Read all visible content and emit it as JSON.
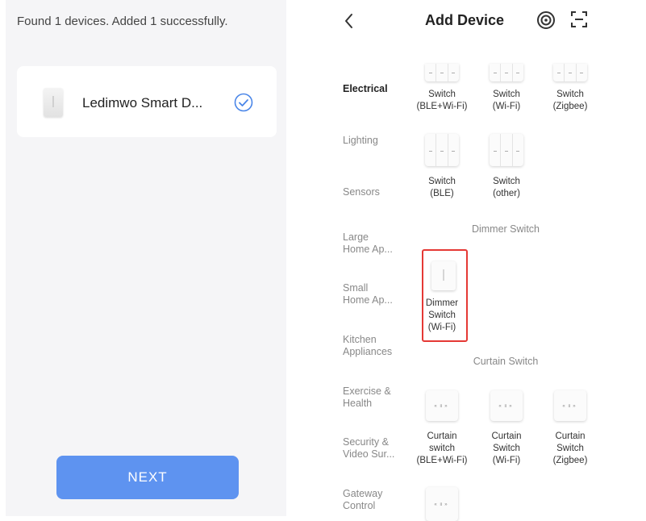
{
  "left_panel": {
    "found_text": "Found 1 devices. Added 1 successfully.",
    "device_name": "Ledimwo Smart D...",
    "next_label": "NEXT"
  },
  "right_panel": {
    "title": "Add Device",
    "categories": [
      {
        "label": "Electrical",
        "active": true
      },
      {
        "label": "Lighting",
        "active": false
      },
      {
        "label": "Sensors",
        "active": false
      },
      {
        "label": "Large\nHome Ap...",
        "active": false
      },
      {
        "label": "Small\nHome Ap...",
        "active": false
      },
      {
        "label": "Kitchen\nAppliances",
        "active": false
      },
      {
        "label": "Exercise &\nHealth",
        "active": false
      },
      {
        "label": "Security &\nVideo Sur...",
        "active": false
      },
      {
        "label": "Gateway\nControl",
        "active": false
      }
    ],
    "switches_row1": [
      "Switch\n(BLE+Wi-Fi)",
      "Switch\n(Wi-Fi)",
      "Switch\n(Zigbee)"
    ],
    "switches_row2": [
      "Switch\n(BLE)",
      "Switch\n(other)"
    ],
    "dimmer_section_title": "Dimmer Switch",
    "dimmer_item": "Dimmer\nSwitch\n(Wi-Fi)",
    "curtain_section_title": "Curtain Switch",
    "curtain_items": [
      "Curtain\nswitch\n(BLE+Wi-Fi)",
      "Curtain\nSwitch\n(Wi-Fi)",
      "Curtain\nSwitch\n(Zigbee)"
    ],
    "icons": {
      "back": "chevron-left-icon",
      "target": "target-icon",
      "scan": "scan-icon",
      "check": "check-circle-icon"
    },
    "colors": {
      "accent": "#5e93f0",
      "highlight": "#e53935"
    }
  }
}
